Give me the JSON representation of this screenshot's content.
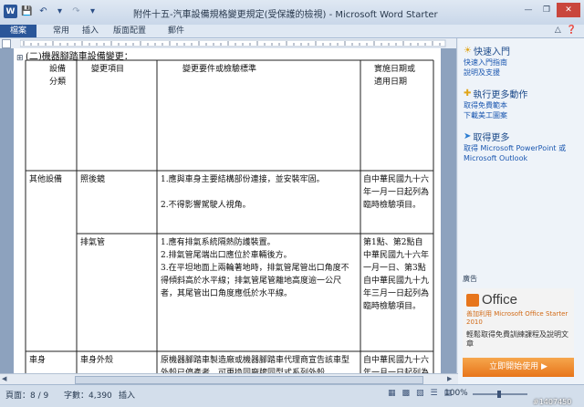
{
  "window": {
    "title": "附件十五-汽車設備規格變更規定(受保護的檢視) - Microsoft Word Starter"
  },
  "ribbon": {
    "tabs": [
      "檔案",
      "常用",
      "插入",
      "版面配置",
      "郵件"
    ]
  },
  "document": {
    "heading": "(二)機器腳踏車設備變更：",
    "headers": {
      "category": "設備分類",
      "item": "變更項目",
      "criteria": "變更要件或檢驗標準",
      "date": "實施日期或適用日期"
    },
    "rows": [
      {
        "category": "其他設備",
        "item": "照後鏡",
        "criteria": [
          "1.應與車身主要結構部份連接，並安裝牢固。",
          "2.不得影響駕駛人視角。"
        ],
        "date": "自中華民國九十六年一月一日起列為臨時檢驗項目。"
      },
      {
        "category": "",
        "item": "排氣管",
        "criteria": [
          "1.應有排氣系統隔熱防護裝置。",
          "2.排氣管尾端出口應位於車輛後方。",
          "3.在平坦地面上兩輪著地時，排氣管尾管出口角度不得傾斜高於水平線；排氣管尾管離地高度逾一公尺者，其尾管出口角度應低於水平線。"
        ],
        "date": "第1點、第2點自中華民國九十六年一月一日、第3點自中華民國九十九年三月一日起列為臨時檢驗項目。"
      },
      {
        "category": "車身",
        "item": "車身外殼",
        "criteria": [
          "原機器腳踏車製造廠或機器腳踏車代理商宣告該車型外殼已停產者，可更換同廠牌同型式系列外殼。"
        ],
        "date": "自中華民國九十六年一月一日起列為臨時檢驗項目。"
      }
    ]
  },
  "pane": {
    "quickstart": {
      "title": "快速入門",
      "links": [
        "快速入門指南",
        "說明及支援"
      ]
    },
    "more_actions": {
      "title": "執行更多動作",
      "links": [
        "取得免費範本",
        "下載美工圖案"
      ]
    },
    "get_more": {
      "title": "取得更多",
      "links": [
        "取得 Microsoft PowerPoint 或",
        "Microsoft Outlook"
      ]
    },
    "ad": {
      "label": "廣告",
      "brand": "Office",
      "promo": "善加利用 Microsoft Office Starter 2010",
      "desc": "輕鬆取得免費訓練課程及說明文章",
      "cta": "立即開始使用"
    }
  },
  "status": {
    "page": "頁面：8 / 9",
    "words": "字數：4,390",
    "mode": "插入",
    "zoom": "100%"
  },
  "watermark": "#1407450",
  "colors": {
    "accent": "#2a5699",
    "office_orange": "#e7751b"
  }
}
